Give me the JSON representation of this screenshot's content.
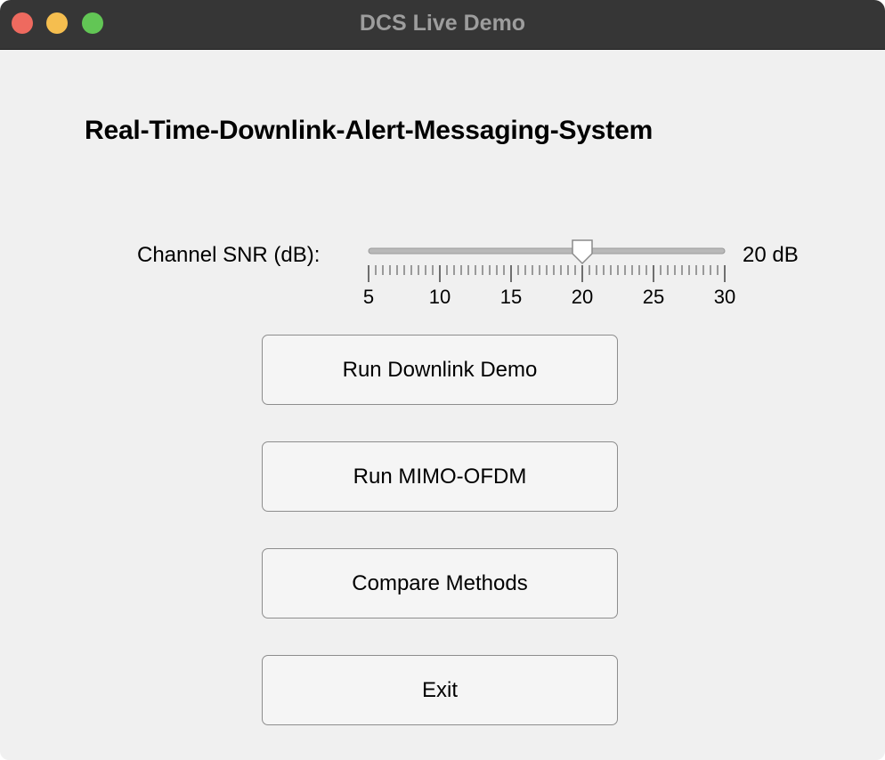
{
  "window": {
    "title": "DCS Live Demo"
  },
  "main": {
    "heading": "Real-Time-Downlink-Alert-Messaging-System",
    "snr": {
      "label": "Channel SNR (dB):",
      "min": 5,
      "max": 30,
      "value": 20,
      "value_text": "20 dB",
      "major_ticks": [
        "5",
        "10",
        "15",
        "20",
        "25",
        "30"
      ],
      "minor_tick_step": 0.5
    },
    "buttons": {
      "run_downlink": "Run Downlink Demo",
      "run_mimo": "Run MIMO-OFDM",
      "compare": "Compare Methods",
      "exit": "Exit"
    }
  }
}
